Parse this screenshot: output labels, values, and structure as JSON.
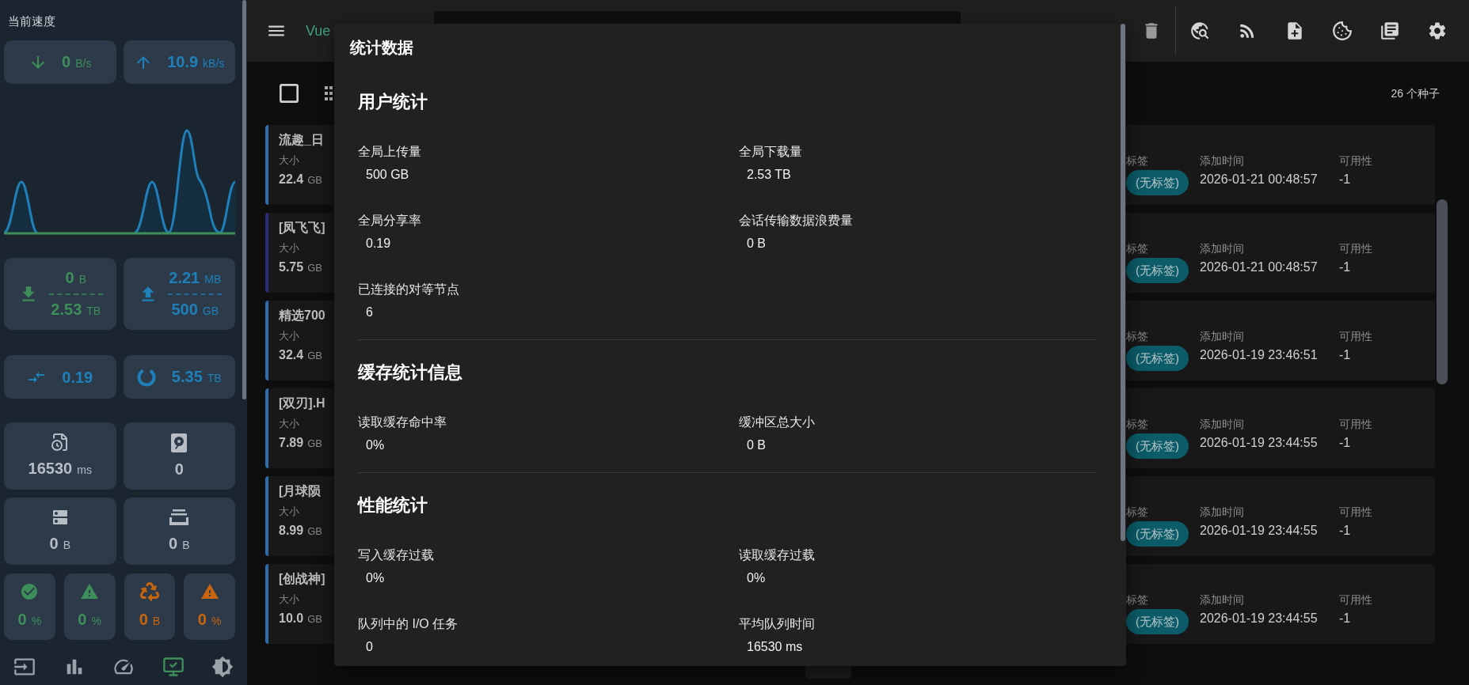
{
  "sidebar": {
    "title": "当前速度",
    "speed": [
      {
        "kind": "download",
        "value": "0",
        "unit": "B/s"
      },
      {
        "kind": "upload",
        "value": "10.9",
        "unit": "kB/s"
      }
    ],
    "transfer": [
      {
        "kind": "download",
        "session": "0",
        "session_unit": "B",
        "total": "2.53",
        "total_unit": "TB"
      },
      {
        "kind": "upload",
        "session": "2.21",
        "session_unit": "MB",
        "total": "500",
        "total_unit": "GB"
      }
    ],
    "summary": [
      {
        "kind": "ratio",
        "value": "0.19"
      },
      {
        "kind": "free_space",
        "value": "5.35",
        "unit": "TB"
      }
    ],
    "stats": [
      {
        "kind": "queue_time",
        "value": "16530",
        "unit": "ms"
      },
      {
        "kind": "disk",
        "value": "0"
      },
      {
        "kind": "buffer",
        "value": "0",
        "unit": "B"
      },
      {
        "kind": "cache",
        "value": "0",
        "unit": "B"
      }
    ],
    "status": [
      {
        "kind": "check",
        "value": "0",
        "unit": "%",
        "color": "#3e8e5a"
      },
      {
        "kind": "alert",
        "value": "0",
        "unit": "%",
        "color": "#3e8e5a"
      },
      {
        "kind": "recycle",
        "value": "0",
        "unit": "B",
        "color": "#c8650e"
      },
      {
        "kind": "alert",
        "value": "0",
        "unit": "%",
        "color": "#c8650e"
      }
    ],
    "nav": [
      {
        "kind": "login",
        "selected": false
      },
      {
        "kind": "chart",
        "selected": false
      },
      {
        "kind": "speed",
        "selected": false
      },
      {
        "kind": "network",
        "selected": true
      },
      {
        "kind": "theme",
        "selected": false
      }
    ]
  },
  "topbar": {
    "title": "Vue",
    "actions": [
      {
        "kind": "delete",
        "disabled": true
      },
      {
        "kind": "web_search",
        "disabled": false
      },
      {
        "kind": "rss",
        "disabled": false
      },
      {
        "kind": "add_file",
        "disabled": false
      },
      {
        "kind": "cookie",
        "disabled": false
      },
      {
        "kind": "logs",
        "disabled": false
      },
      {
        "kind": "settings",
        "disabled": false
      }
    ]
  },
  "toolbar": {
    "select_all": {
      "checked": false
    },
    "count": "26 个种子"
  },
  "torrents": [
    {
      "title": "流趣_日",
      "size_label": "大小",
      "size": "22.4",
      "size_unit": "GB",
      "color": "#2e6dad",
      "tag_label": "标签",
      "tag": "(无标签)",
      "added_label": "添加时间",
      "added": "2026-01-21 00:48:57",
      "availability_label": "可用性",
      "availability": "-1"
    },
    {
      "title": "[凤飞飞]",
      "size_label": "大小",
      "size": "5.75",
      "size_unit": "GB",
      "color": "#2a2d7c",
      "tag_label": "标签",
      "tag": "(无标签)",
      "added_label": "添加时间",
      "added": "2026-01-21 00:48:57",
      "availability_label": "可用性",
      "availability": "-1"
    },
    {
      "title": "精选700",
      "size_label": "大小",
      "size": "32.4",
      "size_unit": "GB",
      "color": "#2e6dad",
      "tag_label": "标签",
      "tag": "(无标签)",
      "added_label": "添加时间",
      "added": "2026-01-19 23:46:51",
      "availability_label": "可用性",
      "availability": "-1"
    },
    {
      "title": "[双刃].H",
      "size_label": "大小",
      "size": "7.89",
      "size_unit": "GB",
      "color": "#2e6dad",
      "tag_label": "标签",
      "tag": "(无标签)",
      "added_label": "添加时间",
      "added": "2026-01-19 23:44:55",
      "availability_label": "可用性",
      "availability": "-1"
    },
    {
      "title": "[月球陨",
      "size_label": "大小",
      "size": "8.99",
      "size_unit": "GB",
      "color": "#2e6dad",
      "tag_label": "标签",
      "tag": "(无标签)",
      "added_label": "添加时间",
      "added": "2026-01-19 23:44:55",
      "availability_label": "可用性",
      "availability": "-1"
    },
    {
      "title": "[创战神]",
      "size_label": "大小",
      "size": "10.0",
      "size_unit": "GB",
      "color": "#2e6dad",
      "tag_label": "标签",
      "tag": "(无标签)",
      "added_label": "添加时间",
      "added": "2026-01-19 23:44:55",
      "availability_label": "可用性",
      "availability": "-1"
    }
  ],
  "dialog": {
    "title": "统计数据",
    "sections": [
      {
        "title": "用户统计",
        "items": [
          {
            "label": "全局上传量",
            "value": "500 GB"
          },
          {
            "label": "全局下载量",
            "value": "2.53 TB"
          },
          {
            "label": "全局分享率",
            "value": "0.19"
          },
          {
            "label": "会话传输数据浪费量",
            "value": "0 B"
          },
          {
            "label": "已连接的对等节点",
            "value": "6"
          }
        ]
      },
      {
        "title": "缓存统计信息",
        "items": [
          {
            "label": "读取缓存命中率",
            "value": "0%"
          },
          {
            "label": "缓冲区总大小",
            "value": "0 B"
          }
        ]
      },
      {
        "title": "性能统计",
        "items": [
          {
            "label": "写入缓存过载",
            "value": "0%"
          },
          {
            "label": "读取缓存过载",
            "value": "0%"
          },
          {
            "label": "队列中的 I/O 任务",
            "value": "0"
          },
          {
            "label": "平均队列时间",
            "value": "16530 ms"
          }
        ]
      }
    ]
  }
}
